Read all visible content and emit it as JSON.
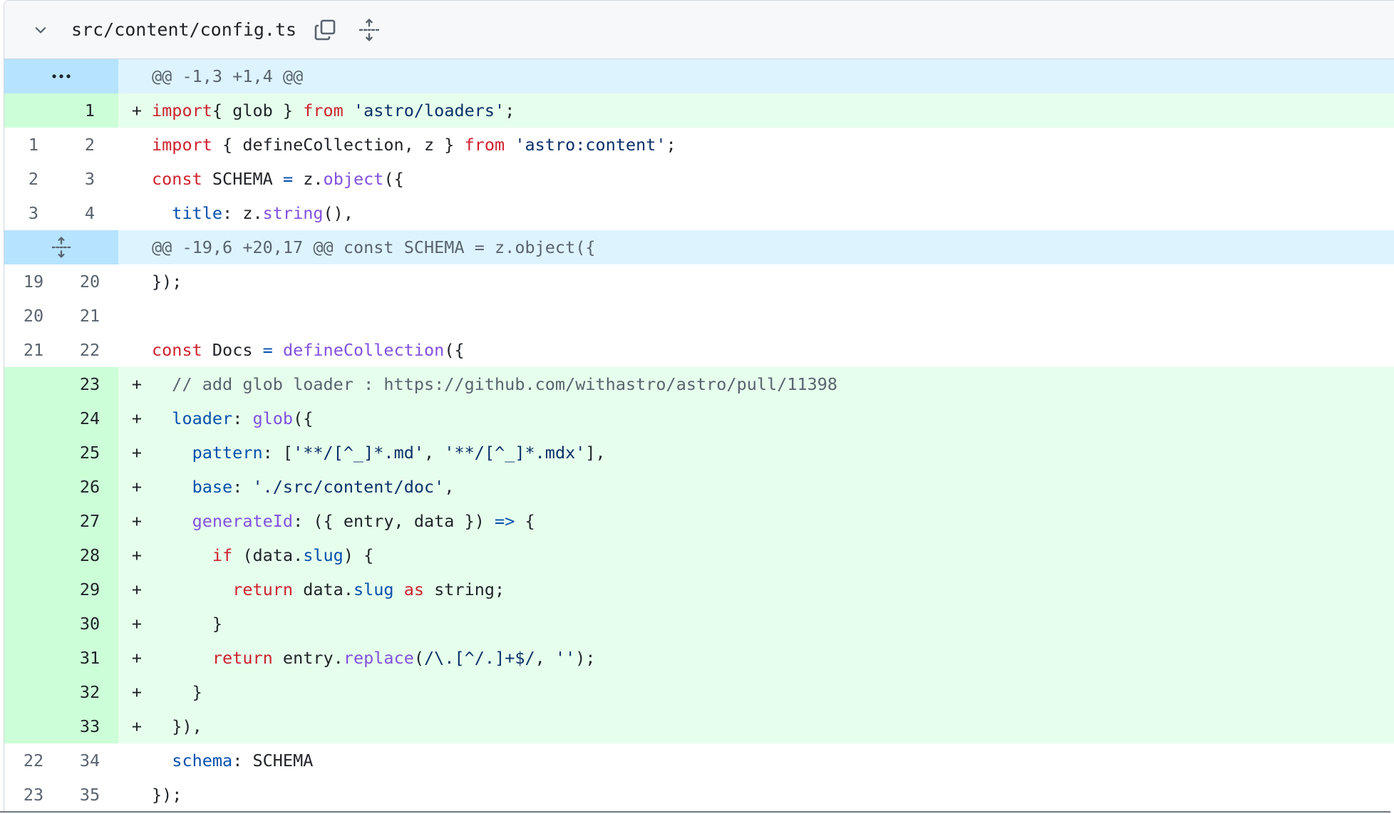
{
  "file": {
    "name": "src/content/config.ts",
    "icons": {
      "collapse": "chevron-down-icon",
      "copy": "copy-icon",
      "expand": "expand-all-icon"
    }
  },
  "colors": {
    "added_line_bg": "#e6ffec",
    "added_gutter_bg": "#ccffd8",
    "hunk_bg": "#ddf4ff",
    "hunk_gutter_bg": "#b6e3ff",
    "keyword": "#cf222e",
    "string": "#0a3069",
    "function": "#8250df",
    "property": "#0550ae"
  },
  "rows": [
    {
      "type": "hunk",
      "icon": "ellipsis-icon",
      "text": "@@ -1,3 +1,4 @@"
    },
    {
      "type": "add",
      "old": "",
      "new": "1",
      "sign": "+",
      "tokens": [
        [
          "kw",
          "import"
        ],
        [
          "",
          "{ glob } "
        ],
        [
          "kw",
          "from"
        ],
        [
          "",
          " "
        ],
        [
          "str",
          "'astro/loaders'"
        ],
        [
          "",
          ";"
        ]
      ]
    },
    {
      "type": "ctx",
      "old": "1",
      "new": "2",
      "sign": "",
      "tokens": [
        [
          "kw",
          "import"
        ],
        [
          "",
          " { defineCollection, z } "
        ],
        [
          "kw",
          "from"
        ],
        [
          "",
          " "
        ],
        [
          "str",
          "'astro:content'"
        ],
        [
          "",
          ";"
        ]
      ]
    },
    {
      "type": "ctx",
      "old": "2",
      "new": "3",
      "sign": "",
      "tokens": [
        [
          "kw",
          "const"
        ],
        [
          "",
          " SCHEMA "
        ],
        [
          "prop",
          "="
        ],
        [
          "",
          " z."
        ],
        [
          "fn",
          "object"
        ],
        [
          "",
          "({"
        ]
      ]
    },
    {
      "type": "ctx",
      "old": "3",
      "new": "4",
      "sign": "",
      "tokens": [
        [
          "",
          "  "
        ],
        [
          "prop",
          "title"
        ],
        [
          "",
          ": z."
        ],
        [
          "fn",
          "string"
        ],
        [
          "",
          "(),"
        ]
      ]
    },
    {
      "type": "hunk",
      "icon": "expand-icon",
      "text": "@@ -19,6 +20,17 @@ const SCHEMA = z.object({"
    },
    {
      "type": "ctx",
      "old": "19",
      "new": "20",
      "sign": "",
      "tokens": [
        [
          "",
          "});"
        ]
      ]
    },
    {
      "type": "ctx",
      "old": "20",
      "new": "21",
      "sign": "",
      "tokens": []
    },
    {
      "type": "ctx",
      "old": "21",
      "new": "22",
      "sign": "",
      "tokens": [
        [
          "kw",
          "const"
        ],
        [
          "",
          " Docs "
        ],
        [
          "prop",
          "="
        ],
        [
          "",
          " "
        ],
        [
          "fn",
          "defineCollection"
        ],
        [
          "",
          "({"
        ]
      ]
    },
    {
      "type": "add",
      "old": "",
      "new": "23",
      "sign": "+",
      "tokens": [
        [
          "cm",
          "  // add glob loader : https://github.com/withastro/astro/pull/11398"
        ]
      ]
    },
    {
      "type": "add",
      "old": "",
      "new": "24",
      "sign": "+",
      "tokens": [
        [
          "",
          "  "
        ],
        [
          "prop",
          "loader"
        ],
        [
          "",
          ": "
        ],
        [
          "fn",
          "glob"
        ],
        [
          "",
          "({"
        ]
      ]
    },
    {
      "type": "add",
      "old": "",
      "new": "25",
      "sign": "+",
      "tokens": [
        [
          "",
          "    "
        ],
        [
          "prop",
          "pattern"
        ],
        [
          "",
          ": ["
        ],
        [
          "str",
          "'**/[^_]*.md'"
        ],
        [
          "",
          ", "
        ],
        [
          "str",
          "'**/[^_]*.mdx'"
        ],
        [
          "",
          "],"
        ]
      ]
    },
    {
      "type": "add",
      "old": "",
      "new": "26",
      "sign": "+",
      "tokens": [
        [
          "",
          "    "
        ],
        [
          "prop",
          "base"
        ],
        [
          "",
          ": "
        ],
        [
          "str",
          "'./src/content/doc'"
        ],
        [
          "",
          ","
        ]
      ]
    },
    {
      "type": "add",
      "old": "",
      "new": "27",
      "sign": "+",
      "tokens": [
        [
          "",
          "    "
        ],
        [
          "fn",
          "generateId"
        ],
        [
          "",
          ": ({ entry, data }) "
        ],
        [
          "prop",
          "=>"
        ],
        [
          "",
          " {"
        ]
      ]
    },
    {
      "type": "add",
      "old": "",
      "new": "28",
      "sign": "+",
      "tokens": [
        [
          "",
          "      "
        ],
        [
          "kw",
          "if"
        ],
        [
          "",
          " (data."
        ],
        [
          "prop",
          "slug"
        ],
        [
          "",
          ") {"
        ]
      ]
    },
    {
      "type": "add",
      "old": "",
      "new": "29",
      "sign": "+",
      "tokens": [
        [
          "",
          "        "
        ],
        [
          "kw",
          "return"
        ],
        [
          "",
          " data."
        ],
        [
          "prop",
          "slug"
        ],
        [
          "",
          " "
        ],
        [
          "kw",
          "as"
        ],
        [
          "",
          " string;"
        ]
      ]
    },
    {
      "type": "add",
      "old": "",
      "new": "30",
      "sign": "+",
      "tokens": [
        [
          "",
          "      }"
        ]
      ]
    },
    {
      "type": "add",
      "old": "",
      "new": "31",
      "sign": "+",
      "tokens": [
        [
          "",
          "      "
        ],
        [
          "kw",
          "return"
        ],
        [
          "",
          " entry."
        ],
        [
          "fn",
          "replace"
        ],
        [
          "",
          "("
        ],
        [
          "str",
          "/\\.[^/.]+$/"
        ],
        [
          "",
          ", "
        ],
        [
          "str",
          "''"
        ],
        [
          "",
          ");"
        ]
      ]
    },
    {
      "type": "add",
      "old": "",
      "new": "32",
      "sign": "+",
      "tokens": [
        [
          "",
          "    }"
        ]
      ]
    },
    {
      "type": "add",
      "old": "",
      "new": "33",
      "sign": "+",
      "tokens": [
        [
          "",
          "  }),"
        ]
      ]
    },
    {
      "type": "ctx",
      "old": "22",
      "new": "34",
      "sign": "",
      "tokens": [
        [
          "",
          "  "
        ],
        [
          "prop",
          "schema"
        ],
        [
          "",
          ": SCHEMA"
        ]
      ]
    },
    {
      "type": "ctx",
      "old": "23",
      "new": "35",
      "sign": "",
      "tokens": [
        [
          "",
          "});"
        ]
      ]
    }
  ]
}
